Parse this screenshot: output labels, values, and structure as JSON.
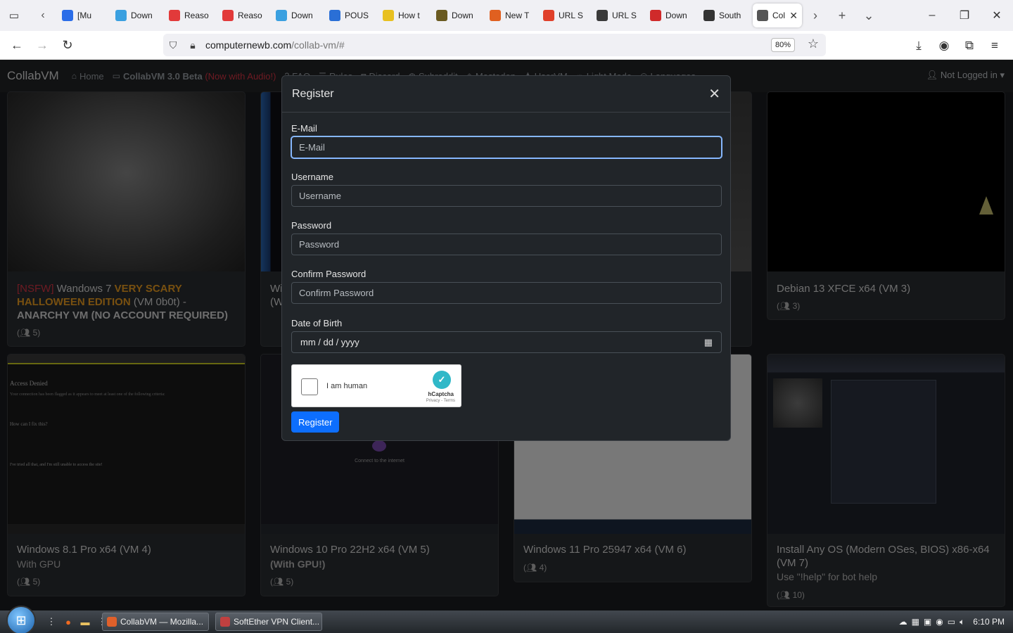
{
  "browser": {
    "tabs": [
      {
        "label": "[Mu",
        "color": "#2b6de8"
      },
      {
        "label": "Down",
        "color": "#3aa0e0"
      },
      {
        "label": "Reaso",
        "color": "#e23a3a"
      },
      {
        "label": "Reaso",
        "color": "#e23a3a"
      },
      {
        "label": "Down",
        "color": "#3aa0e0"
      },
      {
        "label": "POUS",
        "color": "#2a6fd6"
      },
      {
        "label": "How t",
        "color": "#e8c020"
      },
      {
        "label": "Down",
        "color": "#6a5a20"
      },
      {
        "label": "New T",
        "color": "#e06020"
      },
      {
        "label": "URL S",
        "color": "#e0402a"
      },
      {
        "label": "URL S",
        "color": "#3a3a3a"
      },
      {
        "label": "Down",
        "color": "#d02a2a"
      },
      {
        "label": "South",
        "color": "#333"
      },
      {
        "label": "Col",
        "color": "#555",
        "active": true
      }
    ],
    "url": {
      "domain": "computernewb.com",
      "path": "/collab-vm/#"
    },
    "zoom": "80%"
  },
  "site": {
    "brand": "CollabVM",
    "nav": {
      "home": "Home",
      "beta": "CollabVM 3.0 Beta",
      "beta_note": "(Now with Audio!)",
      "faq": "FAQ",
      "rules": "Rules",
      "discord": "Discord",
      "subreddit": "Subreddit",
      "mastodon": "Mastodon",
      "userlist": "UserVM",
      "lightmode": "Light Mode",
      "languages": "Languages"
    },
    "login": "Not Logged in"
  },
  "vms": {
    "vm0": {
      "prefix": "[NSFW]",
      "name": "Wandows 7",
      "scary": "VERY SCARY HALLOWEEN EDITION",
      "suffix": "(VM 0b0t) -",
      "tail": "ANARCHY VM (NO ACCOUNT REQUIRED)",
      "users": "5)"
    },
    "vm1": {
      "name": "Wi",
      "tail": "(W",
      "users": ""
    },
    "vm3": {
      "name": "Debian 13 XFCE x64 (VM 3)",
      "users": "3)"
    },
    "vm4": {
      "name": "Windows 8.1 Pro x64 (VM 4)",
      "sub": "With GPU",
      "users": "5)"
    },
    "vm5": {
      "name": "Windows 10 Pro 22H2 x64 (VM 5)",
      "sub": "(With GPU!)",
      "users": "5)"
    },
    "vm6": {
      "name": "Windows 11 Pro 25947 x64 (VM 6)",
      "users": "4)"
    },
    "vm7": {
      "name": "Install Any OS (Modern OSes, BIOS) x86-x64 (VM 7)",
      "sub": "Use \"!help\" for bot help",
      "users": "10)"
    },
    "vm4_screen": {
      "heading": "Access Denied",
      "body": "Your connection has been flagged as it appears to meet at least one of the following criteria:",
      "q": "How can I fix this?",
      "tried": "I've tried all that, and I'm still unable to access the site!"
    },
    "vm5_screen": {
      "msg": "Connect to the internet"
    }
  },
  "modal": {
    "title": "Register",
    "fields": {
      "email": {
        "label": "E-Mail",
        "placeholder": "E-Mail"
      },
      "username": {
        "label": "Username",
        "placeholder": "Username"
      },
      "password": {
        "label": "Password",
        "placeholder": "Password"
      },
      "confirm": {
        "label": "Confirm Password",
        "placeholder": "Confirm Password"
      },
      "dob": {
        "label": "Date of Birth",
        "value": "mm / dd / yyyy"
      }
    },
    "captcha": {
      "label": "I am human",
      "brand": "hCaptcha",
      "terms": "Privacy - Terms"
    },
    "submit": "Register"
  },
  "taskbar": {
    "windows": [
      {
        "label": "CollabVM — Mozilla...",
        "color": "#e0602a"
      },
      {
        "label": "SoftEther VPN Client...",
        "color": "#c04040"
      }
    ],
    "clock": "6:10 PM"
  }
}
